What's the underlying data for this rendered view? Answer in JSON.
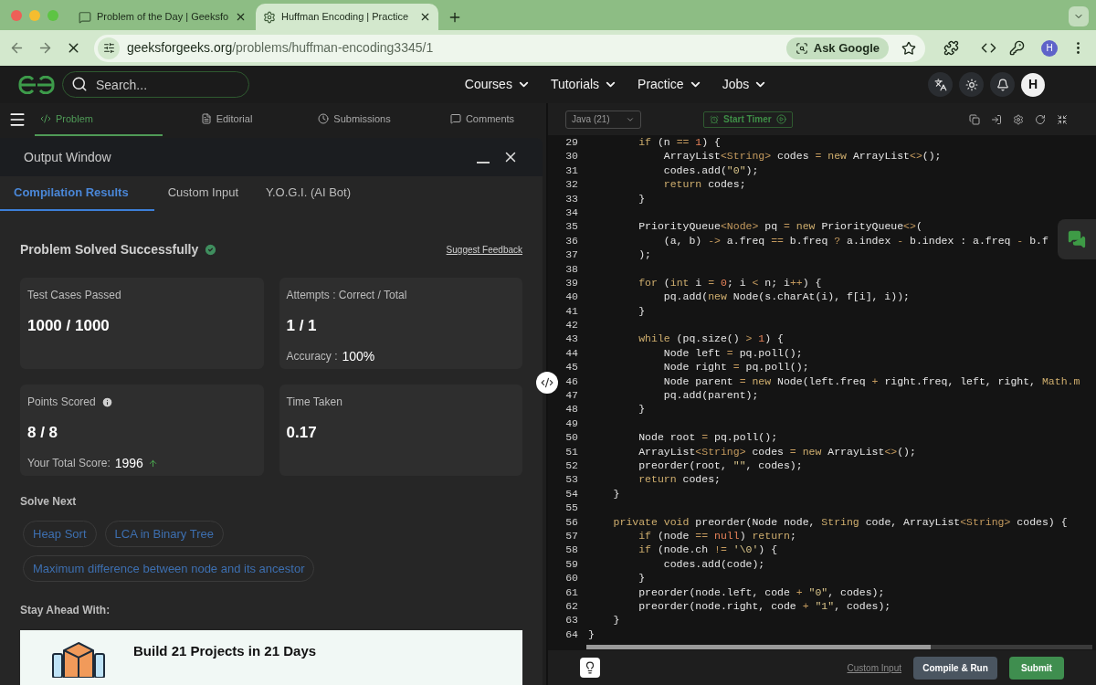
{
  "browser": {
    "tabs": [
      {
        "title": "Problem of the Day | Geeksfo",
        "selected": false
      },
      {
        "title": "Huffman Encoding | Practice",
        "selected": true
      }
    ],
    "url_domain": "geeksforgeeks.org",
    "url_path": "/problems/huffman-encoding3345/1",
    "ask_button": "Ask Google",
    "profile": "H"
  },
  "header": {
    "search_placeholder": "Search...",
    "nav": [
      "Courses",
      "Tutorials",
      "Practice",
      "Jobs"
    ],
    "avatar": "H"
  },
  "problem_tabs": [
    {
      "label": "Problem",
      "selected": true
    },
    {
      "label": "Editorial",
      "selected": false
    },
    {
      "label": "Submissions",
      "selected": false
    },
    {
      "label": "Comments",
      "selected": false
    }
  ],
  "output": {
    "title": "Output Window",
    "tabs": [
      {
        "label": "Compilation Results",
        "selected": true
      },
      {
        "label": "Custom Input",
        "selected": false
      },
      {
        "label": "Y.O.G.I. (AI Bot)",
        "selected": false
      }
    ],
    "status": "Problem Solved Successfully",
    "feedback": "Suggest Feedback",
    "cards": [
      {
        "label": "Test Cases Passed",
        "value": "1000 / 1000"
      },
      {
        "label": "Attempts : Correct / Total",
        "value": "1 / 1",
        "sub_label": "Accuracy :",
        "sub_value": "100%"
      },
      {
        "label": "Points Scored",
        "info": true,
        "value": "8 / 8",
        "sub_label": "Your Total Score:",
        "sub_value": "1996",
        "rising": true
      },
      {
        "label": "Time Taken",
        "value": "0.17"
      }
    ],
    "solve_next_title": "Solve Next",
    "solve_next": [
      "Heap Sort",
      "LCA in Binary Tree",
      "Maximum difference between node and its ancestor"
    ],
    "stay_ahead_title": "Stay Ahead With:",
    "promo_title": "Build 21 Projects in 21 Days"
  },
  "editor": {
    "language": "Java (21)",
    "timer": "Start Timer",
    "lines": [
      {
        "n": "29",
        "t": [
          {
            "kind": "keyword",
            "text": "        if"
          },
          {
            "kind": "plain",
            "text": " (n "
          },
          {
            "kind": "operator",
            "text": "=="
          },
          {
            "kind": "number",
            "text": " 1"
          },
          {
            "kind": "plain",
            "text": ") {"
          }
        ]
      },
      {
        "n": "30",
        "t": [
          {
            "kind": "plain",
            "text": "            ArrayList"
          },
          {
            "kind": "operator",
            "text": "<String>"
          },
          {
            "kind": "plain",
            "text": " codes "
          },
          {
            "kind": "operator",
            "text": "="
          },
          {
            "kind": "keyword",
            "text": " new"
          },
          {
            "kind": "plain",
            "text": " ArrayList"
          },
          {
            "kind": "operator",
            "text": "<>"
          },
          {
            "kind": "plain",
            "text": "();"
          }
        ]
      },
      {
        "n": "31",
        "t": [
          {
            "kind": "plain",
            "text": "            codes.add("
          },
          {
            "kind": "string",
            "text": "\"0\""
          },
          {
            "kind": "plain",
            "text": ");"
          }
        ]
      },
      {
        "n": "32",
        "t": [
          {
            "kind": "keyword",
            "text": "            return"
          },
          {
            "kind": "plain",
            "text": " codes;"
          }
        ]
      },
      {
        "n": "33",
        "t": [
          {
            "kind": "plain",
            "text": "        }"
          }
        ]
      },
      {
        "n": "34"
      },
      {
        "n": "35",
        "t": [
          {
            "kind": "plain",
            "text": "        PriorityQueue"
          },
          {
            "kind": "operator",
            "text": "<Node>"
          },
          {
            "kind": "plain",
            "text": " pq "
          },
          {
            "kind": "operator",
            "text": "="
          },
          {
            "kind": "keyword",
            "text": " new"
          },
          {
            "kind": "plain",
            "text": " PriorityQueue"
          },
          {
            "kind": "operator",
            "text": "<>"
          },
          {
            "kind": "plain",
            "text": "("
          }
        ]
      },
      {
        "n": "36",
        "t": [
          {
            "kind": "plain",
            "text": "            (a, b) "
          },
          {
            "kind": "operator",
            "text": "->"
          },
          {
            "kind": "plain",
            "text": " a.freq "
          },
          {
            "kind": "operator",
            "text": "=="
          },
          {
            "kind": "plain",
            "text": " b.freq "
          },
          {
            "kind": "operator",
            "text": "?"
          },
          {
            "kind": "plain",
            "text": " a.index "
          },
          {
            "kind": "operator",
            "text": "-"
          },
          {
            "kind": "plain",
            "text": " b.index : a.freq "
          },
          {
            "kind": "operator",
            "text": "-"
          },
          {
            "kind": "plain",
            "text": " b.f"
          }
        ]
      },
      {
        "n": "37",
        "t": [
          {
            "kind": "plain",
            "text": "        );"
          }
        ]
      },
      {
        "n": "38"
      },
      {
        "n": "39",
        "t": [
          {
            "kind": "keyword",
            "text": "        for"
          },
          {
            "kind": "plain",
            "text": " ("
          },
          {
            "kind": "keyword",
            "text": "int"
          },
          {
            "kind": "plain",
            "text": " i "
          },
          {
            "kind": "operator",
            "text": "="
          },
          {
            "kind": "number",
            "text": " 0"
          },
          {
            "kind": "plain",
            "text": "; i "
          },
          {
            "kind": "operator",
            "text": "<"
          },
          {
            "kind": "plain",
            "text": " n; i"
          },
          {
            "kind": "operator",
            "text": "++"
          },
          {
            "kind": "plain",
            "text": ") {"
          }
        ]
      },
      {
        "n": "40",
        "t": [
          {
            "kind": "plain",
            "text": "            pq.add("
          },
          {
            "kind": "keyword",
            "text": "new"
          },
          {
            "kind": "plain",
            "text": " Node(s.charAt(i), f[i], i));"
          }
        ]
      },
      {
        "n": "41",
        "t": [
          {
            "kind": "plain",
            "text": "        }"
          }
        ]
      },
      {
        "n": "42"
      },
      {
        "n": "43",
        "t": [
          {
            "kind": "keyword",
            "text": "        while"
          },
          {
            "kind": "plain",
            "text": " (pq.size() "
          },
          {
            "kind": "operator",
            "text": ">"
          },
          {
            "kind": "number",
            "text": " 1"
          },
          {
            "kind": "plain",
            "text": ") {"
          }
        ]
      },
      {
        "n": "44",
        "t": [
          {
            "kind": "plain",
            "text": "            Node left "
          },
          {
            "kind": "operator",
            "text": "="
          },
          {
            "kind": "plain",
            "text": " pq.poll();"
          }
        ]
      },
      {
        "n": "45",
        "t": [
          {
            "kind": "plain",
            "text": "            Node right "
          },
          {
            "kind": "operator",
            "text": "="
          },
          {
            "kind": "plain",
            "text": " pq.poll();"
          }
        ]
      },
      {
        "n": "46",
        "t": [
          {
            "kind": "plain",
            "text": "            Node parent "
          },
          {
            "kind": "operator",
            "text": "="
          },
          {
            "kind": "keyword",
            "text": " new"
          },
          {
            "kind": "plain",
            "text": " Node(left.freq "
          },
          {
            "kind": "operator",
            "text": "+"
          },
          {
            "kind": "plain",
            "text": " right.freq, left, right, "
          },
          {
            "kind": "keyword",
            "text": "Math.m"
          }
        ]
      },
      {
        "n": "47",
        "t": [
          {
            "kind": "plain",
            "text": "            pq.add(parent);"
          }
        ]
      },
      {
        "n": "48",
        "t": [
          {
            "kind": "plain",
            "text": "        }"
          }
        ]
      },
      {
        "n": "49"
      },
      {
        "n": "50",
        "t": [
          {
            "kind": "plain",
            "text": "        Node root "
          },
          {
            "kind": "operator",
            "text": "="
          },
          {
            "kind": "plain",
            "text": " pq.poll();"
          }
        ]
      },
      {
        "n": "51",
        "t": [
          {
            "kind": "plain",
            "text": "        ArrayList"
          },
          {
            "kind": "operator",
            "text": "<String>"
          },
          {
            "kind": "plain",
            "text": " codes "
          },
          {
            "kind": "operator",
            "text": "="
          },
          {
            "kind": "keyword",
            "text": " new"
          },
          {
            "kind": "plain",
            "text": " ArrayList"
          },
          {
            "kind": "operator",
            "text": "<>"
          },
          {
            "kind": "plain",
            "text": "();"
          }
        ]
      },
      {
        "n": "52",
        "t": [
          {
            "kind": "plain",
            "text": "        preorder(root, "
          },
          {
            "kind": "string",
            "text": "\"\""
          },
          {
            "kind": "plain",
            "text": ", codes);"
          }
        ]
      },
      {
        "n": "53",
        "t": [
          {
            "kind": "keyword",
            "text": "        return"
          },
          {
            "kind": "plain",
            "text": " codes;"
          }
        ]
      },
      {
        "n": "54",
        "t": [
          {
            "kind": "plain",
            "text": "    }"
          }
        ]
      },
      {
        "n": "55"
      },
      {
        "n": "56",
        "t": [
          {
            "kind": "keyword",
            "text": "    private void"
          },
          {
            "kind": "plain",
            "text": " preorder(Node node, "
          },
          {
            "kind": "keyword",
            "text": "String"
          },
          {
            "kind": "plain",
            "text": " code, ArrayList"
          },
          {
            "kind": "operator",
            "text": "<String>"
          },
          {
            "kind": "plain",
            "text": " codes) {"
          }
        ]
      },
      {
        "n": "57",
        "t": [
          {
            "kind": "keyword",
            "text": "        if"
          },
          {
            "kind": "plain",
            "text": " (node "
          },
          {
            "kind": "operator",
            "text": "=="
          },
          {
            "kind": "number",
            "text": " null"
          },
          {
            "kind": "plain",
            "text": ") "
          },
          {
            "kind": "keyword",
            "text": "return"
          },
          {
            "kind": "plain",
            "text": ";"
          }
        ]
      },
      {
        "n": "58",
        "t": [
          {
            "kind": "keyword",
            "text": "        if"
          },
          {
            "kind": "plain",
            "text": " (node.ch "
          },
          {
            "kind": "operator",
            "text": "!="
          },
          {
            "kind": "string",
            "text": " '\\0'"
          },
          {
            "kind": "plain",
            "text": ") {"
          }
        ]
      },
      {
        "n": "59",
        "t": [
          {
            "kind": "plain",
            "text": "            codes.add(code);"
          }
        ]
      },
      {
        "n": "60",
        "t": [
          {
            "kind": "plain",
            "text": "        }"
          }
        ]
      },
      {
        "n": "61",
        "t": [
          {
            "kind": "plain",
            "text": "        preorder(node.left, code "
          },
          {
            "kind": "operator",
            "text": "+"
          },
          {
            "kind": "string",
            "text": " \"0\""
          },
          {
            "kind": "plain",
            "text": ", codes);"
          }
        ]
      },
      {
        "n": "62",
        "t": [
          {
            "kind": "plain",
            "text": "        preorder(node.right, code "
          },
          {
            "kind": "operator",
            "text": "+"
          },
          {
            "kind": "string",
            "text": " \"1\""
          },
          {
            "kind": "plain",
            "text": ", codes);"
          }
        ]
      },
      {
        "n": "63",
        "t": [
          {
            "kind": "plain",
            "text": "    }"
          }
        ]
      },
      {
        "n": "64",
        "t": [
          {
            "kind": "plain",
            "text": "}"
          }
        ]
      }
    ]
  },
  "footer": {
    "custom_input": "Custom Input",
    "run": "Compile & Run",
    "submit": "Submit"
  }
}
